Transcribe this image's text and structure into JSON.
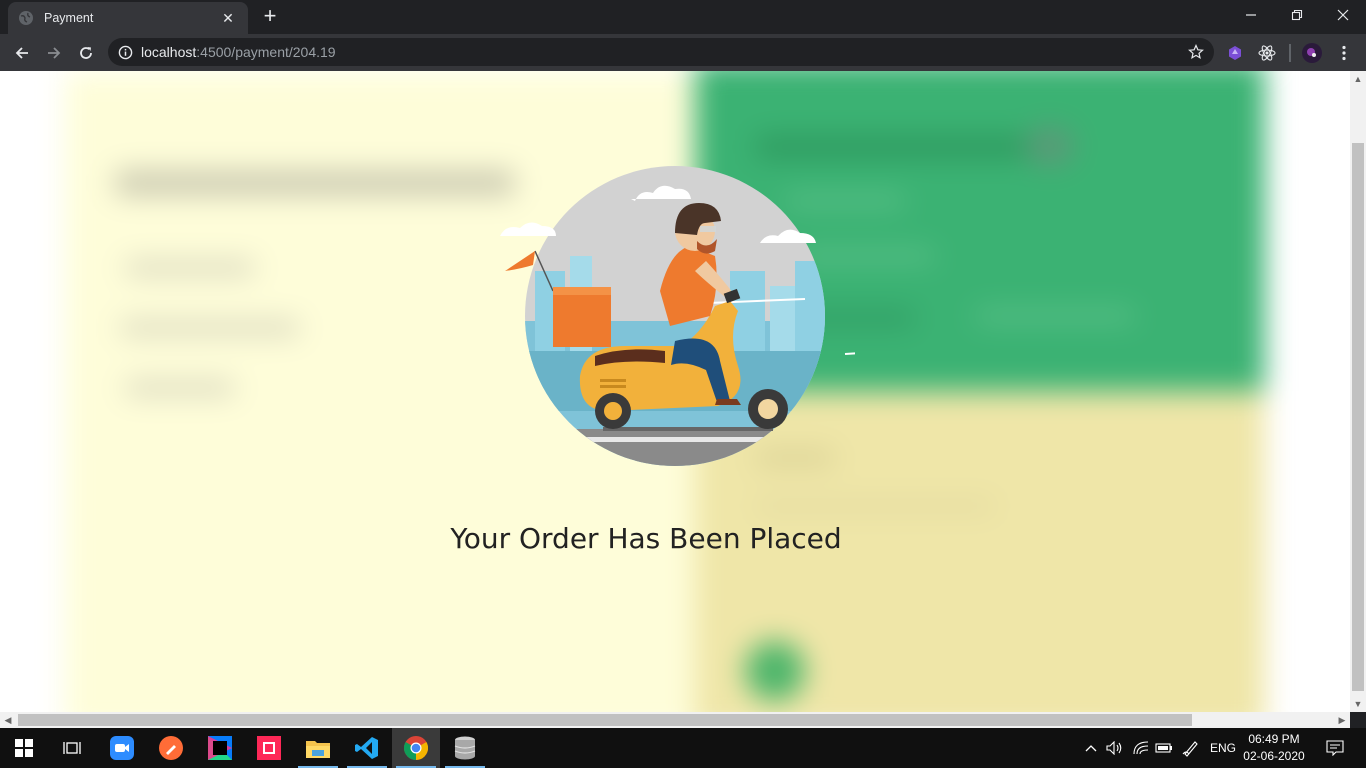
{
  "browser": {
    "tab_title": "Payment",
    "url_host": "localhost",
    "url_path": ":4500/payment/204.19"
  },
  "page": {
    "heading": "Your Order Has Been Placed"
  },
  "taskbar": {
    "time": "06:49 PM",
    "date": "02-06-2020",
    "language": "ENG",
    "apps": [
      "windows-start",
      "task-view",
      "zoom",
      "postman",
      "jetbrains",
      "toolbox",
      "file-explorer",
      "vscode",
      "chrome",
      "database"
    ]
  },
  "colors": {
    "panel_left": "#fefdd9",
    "panel_right_top": "#3bb273",
    "panel_right_bottom": "#efe6a8",
    "scooter": "#f2b13b",
    "shirt": "#ee7a2e"
  }
}
